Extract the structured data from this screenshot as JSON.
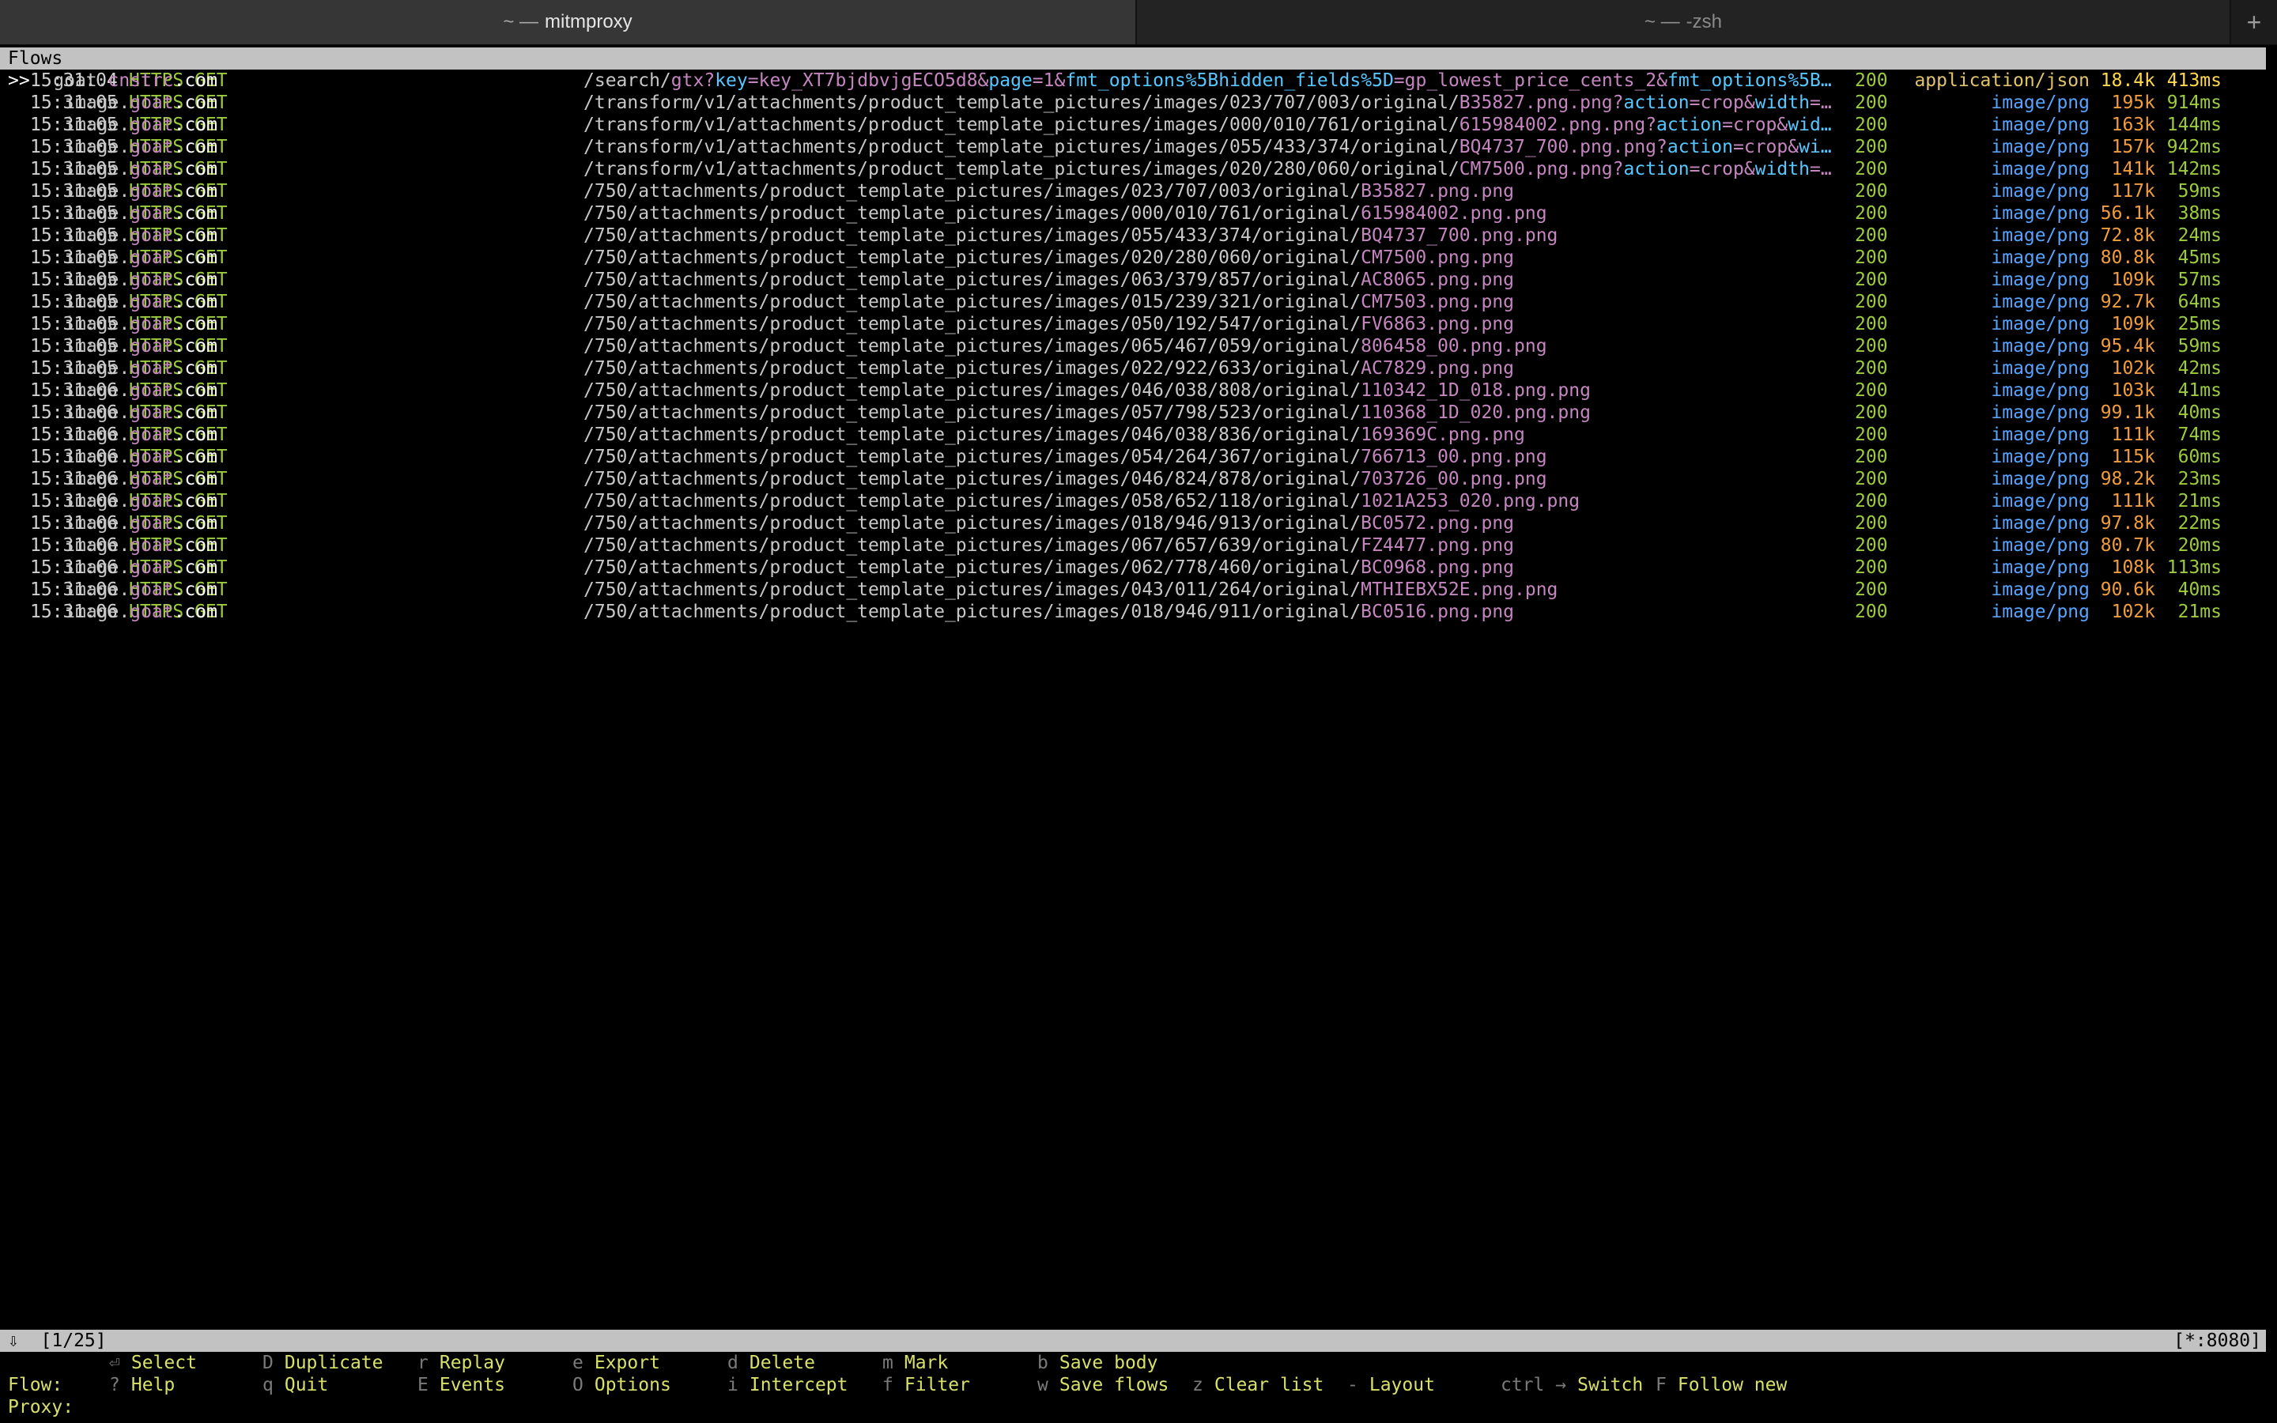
{
  "tabs": [
    {
      "prefix": "~ —",
      "title": "mitmproxy",
      "active": true
    },
    {
      "prefix": "~ —",
      "title": "-zsh",
      "active": false
    }
  ],
  "new_tab_icon": "+",
  "flows_header": "Flows",
  "rows": [
    {
      "cursor": ">>",
      "time": "15:31:04",
      "scheme": "HTTPS",
      "method": "GET",
      "host": [
        "goat.",
        "cnstrc",
        ".com"
      ],
      "path_kind": "search",
      "path_parts": [
        [
          "/search/",
          "b"
        ],
        [
          "gtx",
          "f"
        ],
        [
          "?",
          "q"
        ],
        [
          "key",
          "k"
        ],
        [
          "=",
          "e"
        ],
        [
          "key_XT7bjdbvjgECO5d8",
          "v"
        ],
        [
          "&",
          "a"
        ],
        [
          "page",
          "k"
        ],
        [
          "=",
          "e"
        ],
        [
          "1",
          "v"
        ],
        [
          "&",
          "a"
        ],
        [
          "fmt_options%5Bhidden_fields%5D",
          "k"
        ],
        [
          "=",
          "e"
        ],
        [
          "gp_lowest_price_cents_2",
          "v"
        ],
        [
          "&",
          "a"
        ],
        [
          "fmt_options%5B…",
          "k"
        ]
      ],
      "status": "200",
      "ctype": "application/json",
      "size": "18.4k",
      "dur": "413ms"
    },
    {
      "cursor": "",
      "time": "15:31:05",
      "scheme": "HTTPS",
      "method": "GET",
      "host": [
        "image.",
        "goat",
        ".com"
      ],
      "path_kind": "transform",
      "path_parts": [
        [
          "/transform/v1/attachments/product_template_pictures/images/023/707/003/original/",
          "b"
        ],
        [
          "B35827.png.png",
          "f"
        ],
        [
          "?",
          "q"
        ],
        [
          "action",
          "k"
        ],
        [
          "=",
          "e"
        ],
        [
          "crop",
          "v"
        ],
        [
          "&",
          "a"
        ],
        [
          "width",
          "k"
        ],
        [
          "=…",
          "e"
        ]
      ],
      "status": "200",
      "ctype": "image/png",
      "size": "195k",
      "dur": "914ms"
    },
    {
      "cursor": "",
      "time": "15:31:05",
      "scheme": "HTTPS",
      "method": "GET",
      "host": [
        "image.",
        "goat",
        ".com"
      ],
      "path_kind": "transform",
      "path_parts": [
        [
          "/transform/v1/attachments/product_template_pictures/images/000/010/761/original/",
          "b"
        ],
        [
          "615984002.png.png",
          "f"
        ],
        [
          "?",
          "q"
        ],
        [
          "action",
          "k"
        ],
        [
          "=",
          "e"
        ],
        [
          "crop",
          "v"
        ],
        [
          "&",
          "a"
        ],
        [
          "wid…",
          "k"
        ]
      ],
      "status": "200",
      "ctype": "image/png",
      "size": "163k",
      "dur": "144ms"
    },
    {
      "cursor": "",
      "time": "15:31:05",
      "scheme": "HTTPS",
      "method": "GET",
      "host": [
        "image.",
        "goat",
        ".com"
      ],
      "path_kind": "transform",
      "path_parts": [
        [
          "/transform/v1/attachments/product_template_pictures/images/055/433/374/original/",
          "b"
        ],
        [
          "BQ4737_700.png.png",
          "f"
        ],
        [
          "?",
          "q"
        ],
        [
          "action",
          "k"
        ],
        [
          "=",
          "e"
        ],
        [
          "crop",
          "v"
        ],
        [
          "&",
          "a"
        ],
        [
          "wi…",
          "k"
        ]
      ],
      "status": "200",
      "ctype": "image/png",
      "size": "157k",
      "dur": "942ms"
    },
    {
      "cursor": "",
      "time": "15:31:05",
      "scheme": "HTTPS",
      "method": "GET",
      "host": [
        "image.",
        "goat",
        ".com"
      ],
      "path_kind": "transform",
      "path_parts": [
        [
          "/transform/v1/attachments/product_template_pictures/images/020/280/060/original/",
          "b"
        ],
        [
          "CM7500.png.png",
          "f"
        ],
        [
          "?",
          "q"
        ],
        [
          "action",
          "k"
        ],
        [
          "=",
          "e"
        ],
        [
          "crop",
          "v"
        ],
        [
          "&",
          "a"
        ],
        [
          "width",
          "k"
        ],
        [
          "=…",
          "e"
        ]
      ],
      "status": "200",
      "ctype": "image/png",
      "size": "141k",
      "dur": "142ms"
    },
    {
      "cursor": "",
      "time": "15:31:05",
      "scheme": "HTTPS",
      "method": "GET",
      "host": [
        "image.",
        "goat",
        ".com"
      ],
      "path_parts": [
        [
          "/750/attachments/product_template_pictures/images/023/707/003/original/",
          "b"
        ],
        [
          "B35827.png.png",
          "f"
        ]
      ],
      "status": "200",
      "ctype": "image/png",
      "size": "117k",
      "dur": "59ms"
    },
    {
      "cursor": "",
      "time": "15:31:05",
      "scheme": "HTTPS",
      "method": "GET",
      "host": [
        "image.",
        "goat",
        ".com"
      ],
      "path_parts": [
        [
          "/750/attachments/product_template_pictures/images/000/010/761/original/",
          "b"
        ],
        [
          "615984002.png.png",
          "f"
        ]
      ],
      "status": "200",
      "ctype": "image/png",
      "size": "56.1k",
      "dur": "38ms"
    },
    {
      "cursor": "",
      "time": "15:31:05",
      "scheme": "HTTPS",
      "method": "GET",
      "host": [
        "image.",
        "goat",
        ".com"
      ],
      "path_parts": [
        [
          "/750/attachments/product_template_pictures/images/055/433/374/original/",
          "b"
        ],
        [
          "BQ4737_700.png.png",
          "f"
        ]
      ],
      "status": "200",
      "ctype": "image/png",
      "size": "72.8k",
      "dur": "24ms"
    },
    {
      "cursor": "",
      "time": "15:31:05",
      "scheme": "HTTPS",
      "method": "GET",
      "host": [
        "image.",
        "goat",
        ".com"
      ],
      "path_parts": [
        [
          "/750/attachments/product_template_pictures/images/020/280/060/original/",
          "b"
        ],
        [
          "CM7500.png.png",
          "f"
        ]
      ],
      "status": "200",
      "ctype": "image/png",
      "size": "80.8k",
      "dur": "45ms"
    },
    {
      "cursor": "",
      "time": "15:31:05",
      "scheme": "HTTPS",
      "method": "GET",
      "host": [
        "image.",
        "goat",
        ".com"
      ],
      "path_parts": [
        [
          "/750/attachments/product_template_pictures/images/063/379/857/original/",
          "b"
        ],
        [
          "AC8065.png.png",
          "f"
        ]
      ],
      "status": "200",
      "ctype": "image/png",
      "size": "109k",
      "dur": "57ms"
    },
    {
      "cursor": "",
      "time": "15:31:05",
      "scheme": "HTTPS",
      "method": "GET",
      "host": [
        "image.",
        "goat",
        ".com"
      ],
      "path_parts": [
        [
          "/750/attachments/product_template_pictures/images/015/239/321/original/",
          "b"
        ],
        [
          "CM7503.png.png",
          "f"
        ]
      ],
      "status": "200",
      "ctype": "image/png",
      "size": "92.7k",
      "dur": "64ms"
    },
    {
      "cursor": "",
      "time": "15:31:05",
      "scheme": "HTTPS",
      "method": "GET",
      "host": [
        "image.",
        "goat",
        ".com"
      ],
      "path_parts": [
        [
          "/750/attachments/product_template_pictures/images/050/192/547/original/",
          "b"
        ],
        [
          "FV6863.png.png",
          "f"
        ]
      ],
      "status": "200",
      "ctype": "image/png",
      "size": "109k",
      "dur": "25ms"
    },
    {
      "cursor": "",
      "time": "15:31:05",
      "scheme": "HTTPS",
      "method": "GET",
      "host": [
        "image.",
        "goat",
        ".com"
      ],
      "path_parts": [
        [
          "/750/attachments/product_template_pictures/images/065/467/059/original/",
          "b"
        ],
        [
          "806458_00.png.png",
          "f"
        ]
      ],
      "status": "200",
      "ctype": "image/png",
      "size": "95.4k",
      "dur": "59ms"
    },
    {
      "cursor": "",
      "time": "15:31:05",
      "scheme": "HTTPS",
      "method": "GET",
      "host": [
        "image.",
        "goat",
        ".com"
      ],
      "path_parts": [
        [
          "/750/attachments/product_template_pictures/images/022/922/633/original/",
          "b"
        ],
        [
          "AC7829.png.png",
          "f"
        ]
      ],
      "status": "200",
      "ctype": "image/png",
      "size": "102k",
      "dur": "42ms"
    },
    {
      "cursor": "",
      "time": "15:31:06",
      "scheme": "HTTPS",
      "method": "GET",
      "host": [
        "image.",
        "goat",
        ".com"
      ],
      "path_parts": [
        [
          "/750/attachments/product_template_pictures/images/046/038/808/original/",
          "b"
        ],
        [
          "110342_1D_018.png.png",
          "f"
        ]
      ],
      "status": "200",
      "ctype": "image/png",
      "size": "103k",
      "dur": "41ms"
    },
    {
      "cursor": "",
      "time": "15:31:06",
      "scheme": "HTTPS",
      "method": "GET",
      "host": [
        "image.",
        "goat",
        ".com"
      ],
      "path_parts": [
        [
          "/750/attachments/product_template_pictures/images/057/798/523/original/",
          "b"
        ],
        [
          "110368_1D_020.png.png",
          "f"
        ]
      ],
      "status": "200",
      "ctype": "image/png",
      "size": "99.1k",
      "dur": "40ms"
    },
    {
      "cursor": "",
      "time": "15:31:06",
      "scheme": "HTTPS",
      "method": "GET",
      "host": [
        "image.",
        "goat",
        ".com"
      ],
      "path_parts": [
        [
          "/750/attachments/product_template_pictures/images/046/038/836/original/",
          "b"
        ],
        [
          "169369C.png.png",
          "f"
        ]
      ],
      "status": "200",
      "ctype": "image/png",
      "size": "111k",
      "dur": "74ms"
    },
    {
      "cursor": "",
      "time": "15:31:06",
      "scheme": "HTTPS",
      "method": "GET",
      "host": [
        "image.",
        "goat",
        ".com"
      ],
      "path_parts": [
        [
          "/750/attachments/product_template_pictures/images/054/264/367/original/",
          "b"
        ],
        [
          "766713_00.png.png",
          "f"
        ]
      ],
      "status": "200",
      "ctype": "image/png",
      "size": "115k",
      "dur": "60ms"
    },
    {
      "cursor": "",
      "time": "15:31:06",
      "scheme": "HTTPS",
      "method": "GET",
      "host": [
        "image.",
        "goat",
        ".com"
      ],
      "path_parts": [
        [
          "/750/attachments/product_template_pictures/images/046/824/878/original/",
          "b"
        ],
        [
          "703726_00.png.png",
          "f"
        ]
      ],
      "status": "200",
      "ctype": "image/png",
      "size": "98.2k",
      "dur": "23ms"
    },
    {
      "cursor": "",
      "time": "15:31:06",
      "scheme": "HTTPS",
      "method": "GET",
      "host": [
        "image.",
        "goat",
        ".com"
      ],
      "path_parts": [
        [
          "/750/attachments/product_template_pictures/images/058/652/118/original/",
          "b"
        ],
        [
          "1021A253_020.png.png",
          "f"
        ]
      ],
      "status": "200",
      "ctype": "image/png",
      "size": "111k",
      "dur": "21ms"
    },
    {
      "cursor": "",
      "time": "15:31:06",
      "scheme": "HTTPS",
      "method": "GET",
      "host": [
        "image.",
        "goat",
        ".com"
      ],
      "path_parts": [
        [
          "/750/attachments/product_template_pictures/images/018/946/913/original/",
          "b"
        ],
        [
          "BC0572.png.png",
          "f"
        ]
      ],
      "status": "200",
      "ctype": "image/png",
      "size": "97.8k",
      "dur": "22ms"
    },
    {
      "cursor": "",
      "time": "15:31:06",
      "scheme": "HTTPS",
      "method": "GET",
      "host": [
        "image.",
        "goat",
        ".com"
      ],
      "path_parts": [
        [
          "/750/attachments/product_template_pictures/images/067/657/639/original/",
          "b"
        ],
        [
          "FZ4477.png.png",
          "f"
        ]
      ],
      "status": "200",
      "ctype": "image/png",
      "size": "80.7k",
      "dur": "20ms"
    },
    {
      "cursor": "",
      "time": "15:31:06",
      "scheme": "HTTPS",
      "method": "GET",
      "host": [
        "image.",
        "goat",
        ".com"
      ],
      "path_parts": [
        [
          "/750/attachments/product_template_pictures/images/062/778/460/original/",
          "b"
        ],
        [
          "BC0968.png.png",
          "f"
        ]
      ],
      "status": "200",
      "ctype": "image/png",
      "size": "108k",
      "dur": "113ms"
    },
    {
      "cursor": "",
      "time": "15:31:06",
      "scheme": "HTTPS",
      "method": "GET",
      "host": [
        "image.",
        "goat",
        ".com"
      ],
      "path_parts": [
        [
          "/750/attachments/product_template_pictures/images/043/011/264/original/",
          "b"
        ],
        [
          "MTHIEBX52E.png.png",
          "f"
        ]
      ],
      "status": "200",
      "ctype": "image/png",
      "size": "90.6k",
      "dur": "40ms"
    },
    {
      "cursor": "",
      "time": "15:31:06",
      "scheme": "HTTPS",
      "method": "GET",
      "host": [
        "image.",
        "goat",
        ".com"
      ],
      "path_parts": [
        [
          "/750/attachments/product_template_pictures/images/018/946/911/original/",
          "b"
        ],
        [
          "BC0516.png.png",
          "f"
        ]
      ],
      "status": "200",
      "ctype": "image/png",
      "size": "102k",
      "dur": "21ms"
    }
  ],
  "status_bar": {
    "left": "⇩  [1/25]",
    "right": "[*:8080]"
  },
  "flow_keys": {
    "label": "Flow:",
    "items": [
      {
        "key": "⏎",
        "text": "Select"
      },
      {
        "key": "D",
        "text": "Duplicate"
      },
      {
        "key": "r",
        "text": "Replay"
      },
      {
        "key": "e",
        "text": "Export"
      },
      {
        "key": "d",
        "text": "Delete"
      },
      {
        "key": "m",
        "text": "Mark"
      },
      {
        "key": "b",
        "text": "Save body"
      }
    ]
  },
  "proxy_keys": {
    "label": "Proxy:",
    "items": [
      {
        "key": "?",
        "text": "Help"
      },
      {
        "key": "q",
        "text": "Quit"
      },
      {
        "key": "E",
        "text": "Events"
      },
      {
        "key": "O",
        "text": "Options"
      },
      {
        "key": "i",
        "text": "Intercept"
      },
      {
        "key": "f",
        "text": "Filter"
      },
      {
        "key": "w",
        "text": "Save flows"
      },
      {
        "key": "z",
        "text": "Clear list"
      },
      {
        "key": "-",
        "text": "Layout"
      },
      {
        "key": "ctrl →",
        "text": "Switch"
      },
      {
        "key": "F",
        "text": "Follow new"
      }
    ]
  }
}
